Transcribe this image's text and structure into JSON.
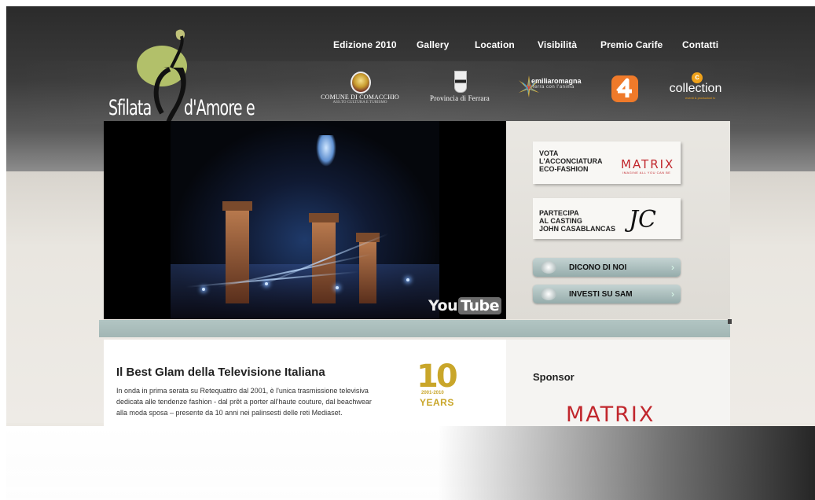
{
  "logo": {
    "word1": "Sfilata",
    "word2": "d'Amore e Moda"
  },
  "nav": [
    "Edizione 2010",
    "Gallery",
    "Location",
    "Visibilità",
    "Premio Carife",
    "Contatti"
  ],
  "partners": {
    "comacchio": {
      "line1": "COMUNE DI COMACCHIO",
      "line2": "ASS.TO CULTURA E TURISMO"
    },
    "ferrara": "Provincia di Ferrara",
    "emilia": {
      "line1": "emiliaromagna",
      "line2": "terra con l'anima"
    },
    "collection": {
      "line1": "collection",
      "line2": "eventi & produzioni tv"
    }
  },
  "video": {
    "logo_you": "You",
    "logo_tube": "Tube"
  },
  "side": {
    "card1": {
      "line1": "VOTA",
      "line2": "L'ACCONCIATURA",
      "line3": "ECO-FASHION",
      "brand": "MATRIX",
      "tagline": "IMAGINE ALL YOU CAN BE"
    },
    "card2": {
      "line1": "PARTECIPA",
      "line2": "AL CASTING",
      "line3": "JOHN CASABLANCAS",
      "mark": "JC"
    },
    "btn1": "DICONO DI NOI",
    "btn2": "INVESTI SU SAM"
  },
  "content": {
    "title": "Il Best Glam della Televisione Italiana",
    "paragraph_1": "In onda in prima serata su Retequattro dal 2001, è l'unica trasmissione televisiva",
    "paragraph_2": "dedicata alle tendenze fashion - dal prêt a porter all'haute couture, dal beachwear",
    "paragraph_3": "alla moda sposa – presente da 10 anni nei palinsesti delle reti Mediaset.",
    "badge_num": "10",
    "badge_years": "2001-2010",
    "badge_label": "YEARS"
  },
  "sponsor": {
    "title": "Sponsor",
    "logo": "MATRIX"
  },
  "colors": {
    "accent": "#c1272d",
    "gold": "#c9a62a",
    "button": "#a9bdbc"
  }
}
